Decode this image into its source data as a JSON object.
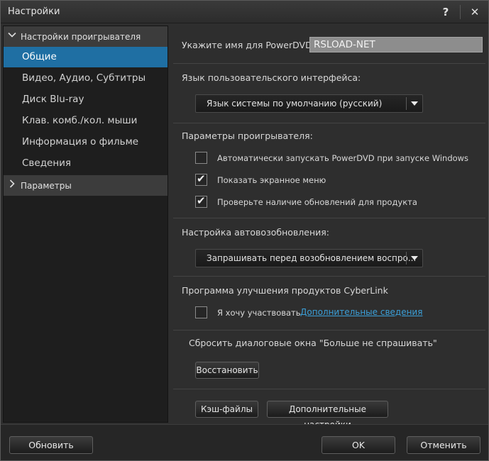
{
  "window": {
    "title": "Настройки",
    "help_glyph": "?",
    "close_glyph": "✕"
  },
  "sidebar": {
    "group_player": {
      "label": "Настройки проигрывателя",
      "icon": "chevron-down-icon"
    },
    "items": [
      {
        "label": "Общие",
        "active": true
      },
      {
        "label": "Видео, Аудио, Субтитры",
        "active": false
      },
      {
        "label": "Диск Blu-ray",
        "active": false
      },
      {
        "label": "Клав. комб./кол. мыши",
        "active": false
      },
      {
        "label": "Информация о фильме",
        "active": false
      },
      {
        "label": "Сведения",
        "active": false
      }
    ],
    "group_params": {
      "label": "Параметры",
      "icon": "chevron-right-icon"
    }
  },
  "main": {
    "name_label": "Укажите имя для PowerDVD:",
    "name_value": "RSLOAD-NET",
    "ui_language": {
      "label": "Язык пользовательского интерфейса:",
      "selected": "Язык системы по умолчанию (русский)"
    },
    "player_params": {
      "label": "Параметры проигрывателя:",
      "options": [
        {
          "label": "Автоматически запускать PowerDVD при запуске Windows",
          "checked": false
        },
        {
          "label": "Показать экранное меню",
          "checked": true
        },
        {
          "label": "Проверьте наличие обновлений для продукта",
          "checked": true
        }
      ]
    },
    "resume": {
      "label": "Настройка автовозобновления:",
      "selected": "Запрашивать перед возобновлением воспро..."
    },
    "cyberlink": {
      "label": "Программа улучшения продуктов CyberLink",
      "participate_label": "Я хочу участвовать",
      "participate_checked": false,
      "more_info_link": "Дополнительные сведения"
    },
    "reset_dialogs": {
      "label": "Сбросить диалоговые окна \"Больше не спрашивать\"",
      "restore_button": "Восстановить"
    },
    "cache_button": "Кэш-файлы",
    "advanced_button": "Дополнительные настройки"
  },
  "footer": {
    "update_button": "Обновить",
    "ok_button": "OK",
    "cancel_button": "Отменить"
  },
  "colors": {
    "active_item": "#1f6fa3",
    "link": "#3b9fd8",
    "background": "#2e2e2e"
  }
}
